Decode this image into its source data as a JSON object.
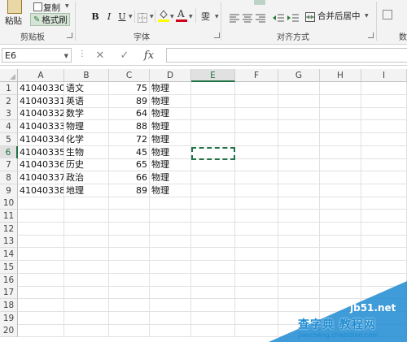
{
  "ribbon": {
    "clipboard": {
      "paste": "粘贴",
      "copy": "复制",
      "format_painter": "格式刷",
      "group_label": "剪贴板"
    },
    "font": {
      "bold": "B",
      "italic": "I",
      "underline": "U",
      "group_label": "字体"
    },
    "alignment": {
      "wrap_glyph": "ab",
      "merge_center": "合并后居中",
      "group_label": "对齐方式"
    },
    "number": {
      "group_label": "数"
    }
  },
  "formula_bar": {
    "name_box": "E6",
    "fx": "fx",
    "cancel": "✕",
    "confirm": "✓",
    "value": ""
  },
  "columns": [
    "A",
    "B",
    "C",
    "D",
    "E",
    "F",
    "G",
    "H",
    "I"
  ],
  "selected_column": "E",
  "selected_row": "6",
  "rows": [
    "1",
    "2",
    "3",
    "4",
    "5",
    "6",
    "7",
    "8",
    "9",
    "10",
    "11",
    "12",
    "13",
    "14",
    "15",
    "16",
    "17",
    "18",
    "19",
    "20"
  ],
  "table": [
    [
      "41040330",
      "语文",
      "75",
      "物理"
    ],
    [
      "41040331",
      "英语",
      "89",
      "物理"
    ],
    [
      "41040332",
      "数学",
      "64",
      "物理"
    ],
    [
      "41040333",
      "物理",
      "88",
      "物理"
    ],
    [
      "41040334",
      "化学",
      "72",
      "物理"
    ],
    [
      "41040335",
      "生物",
      "45",
      "物理"
    ],
    [
      "41040336",
      "历史",
      "65",
      "物理"
    ],
    [
      "41040337",
      "政治",
      "66",
      "物理"
    ],
    [
      "41040338",
      "地理",
      "89",
      "物理"
    ]
  ],
  "watermark": {
    "line1": "jb51.net",
    "line2": "查字典 教程网",
    "line3": "jiaocheng.chazidian.com"
  },
  "colors": {
    "accent": "#217346",
    "watermark": "#1d8bd1"
  }
}
